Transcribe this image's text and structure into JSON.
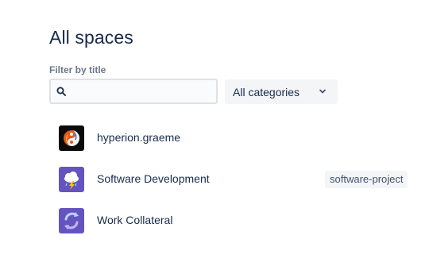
{
  "page": {
    "title": "All spaces"
  },
  "filter": {
    "label": "Filter by title",
    "search_value": "",
    "search_placeholder": "",
    "category_selected": "All categories"
  },
  "spaces": [
    {
      "name": "hyperion.graeme",
      "category": "",
      "icon": "personal-avatar-icon"
    },
    {
      "name": "Software Development",
      "category": "software-project",
      "icon": "cloud-storm-icon"
    },
    {
      "name": "Work Collateral",
      "category": "",
      "icon": "refresh-cycle-icon"
    }
  ],
  "colors": {
    "text_primary": "#172B4D",
    "text_subtle": "#6B778C",
    "space_purple": "#6554C0",
    "field_border": "#DFE1E6",
    "lozenge_bg": "#F4F5F7"
  }
}
